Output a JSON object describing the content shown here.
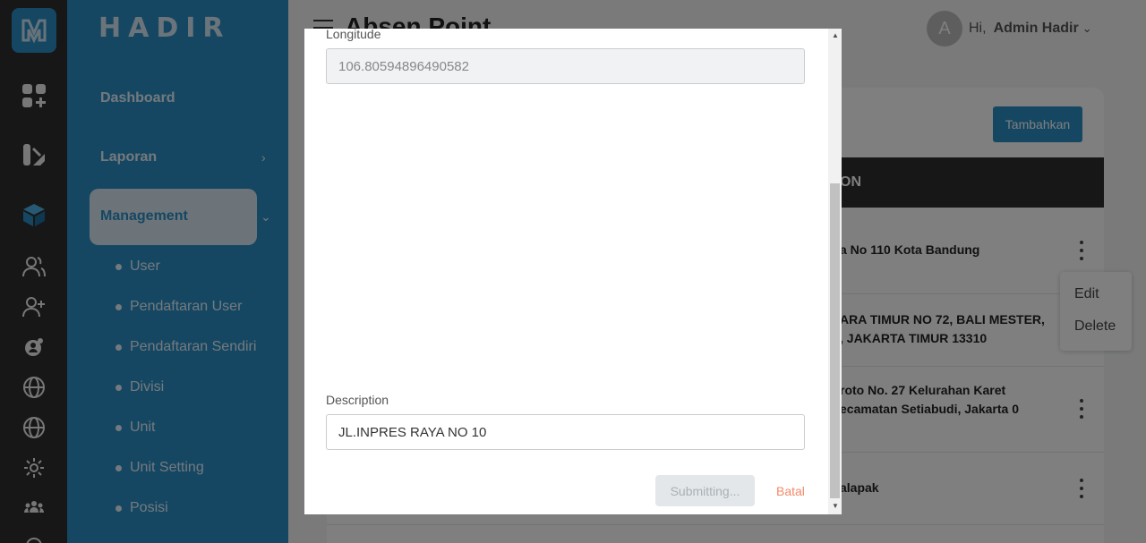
{
  "brand": "HADIR",
  "page_title": "Absen Point",
  "nav": {
    "dashboard": "Dashboard",
    "laporan": "Laporan",
    "management": "Management",
    "sub_items": [
      "User",
      "Pendaftaran User",
      "Pendaftaran Sendiri",
      "Divisi",
      "Unit",
      "Unit Setting",
      "Posisi"
    ]
  },
  "rail_icons": [
    "apps-add-icon",
    "report-icon",
    "cube-icon",
    "users-icon",
    "user-add-icon",
    "user-settings-icon",
    "globe-icon",
    "globe-icon",
    "gear-icon",
    "group-icon"
  ],
  "user": {
    "avatar_initial": "A",
    "greeting": "Hi,",
    "name": "Admin Hadir"
  },
  "toolbar": {
    "add_label": "Tambahkan"
  },
  "table": {
    "header_partial": "ON",
    "rows": [
      {
        "text": "a No 110 Kota Bandung"
      },
      {
        "text": "ARA TIMUR NO 72, BALI MESTER, , JAKARTA TIMUR 13310"
      },
      {
        "text": "roto No. 27 Kelurahan Karet ecamatan Setiabudi, Jakarta 0"
      },
      {
        "text": "alapak"
      }
    ]
  },
  "context_menu": {
    "edit": "Edit",
    "delete": "Delete"
  },
  "modal": {
    "longitude_label": "Longitude",
    "longitude_value": "106.80594896490582",
    "description_label": "Description",
    "description_value": "JL.INPRES RAYA NO 10",
    "submit_label": "Submitting...",
    "cancel_label": "Batal"
  },
  "colors": {
    "primary": "#2a8fc6",
    "rail": "#2e2e2e",
    "cancel": "#f3896a"
  }
}
